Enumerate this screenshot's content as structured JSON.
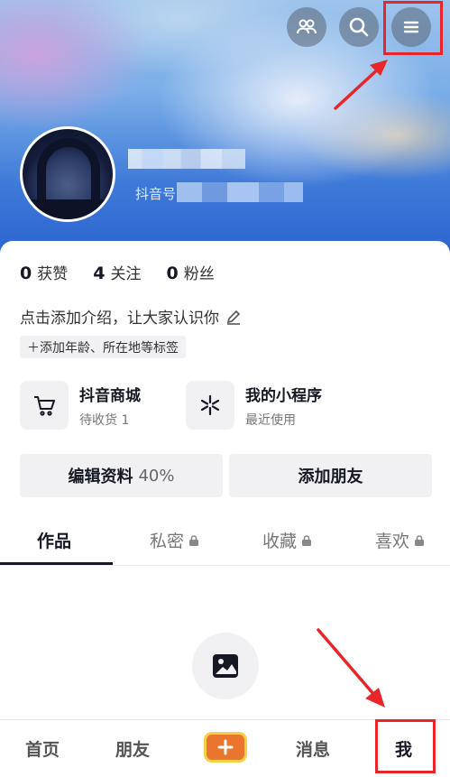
{
  "stats": [
    {
      "num": "0",
      "label": "获赞"
    },
    {
      "num": "4",
      "label": "关注"
    },
    {
      "num": "0",
      "label": "粉丝"
    }
  ],
  "profile": {
    "douyin_id_label": "抖音号",
    "bio_placeholder": "点击添加介绍，让大家认识你",
    "tag_chip": "＋添加年龄、所在地等标签"
  },
  "tiles": {
    "store": {
      "title": "抖音商城",
      "subtitle": "待收货 1"
    },
    "mini": {
      "title": "我的小程序",
      "subtitle": "最近使用"
    }
  },
  "buttons": {
    "edit_profile": "编辑资料",
    "edit_percent": "40%",
    "add_friend": "添加朋友"
  },
  "tabs": [
    "作品",
    "私密",
    "收藏",
    "喜欢"
  ],
  "nav": {
    "home": "首页",
    "friends": "朋友",
    "plus": "+",
    "messages": "消息",
    "me": "我"
  },
  "colors": {
    "annotation_red": "#e8262a",
    "plus_orange": "#e9752e",
    "plus_border_yellow": "#f6d047"
  }
}
